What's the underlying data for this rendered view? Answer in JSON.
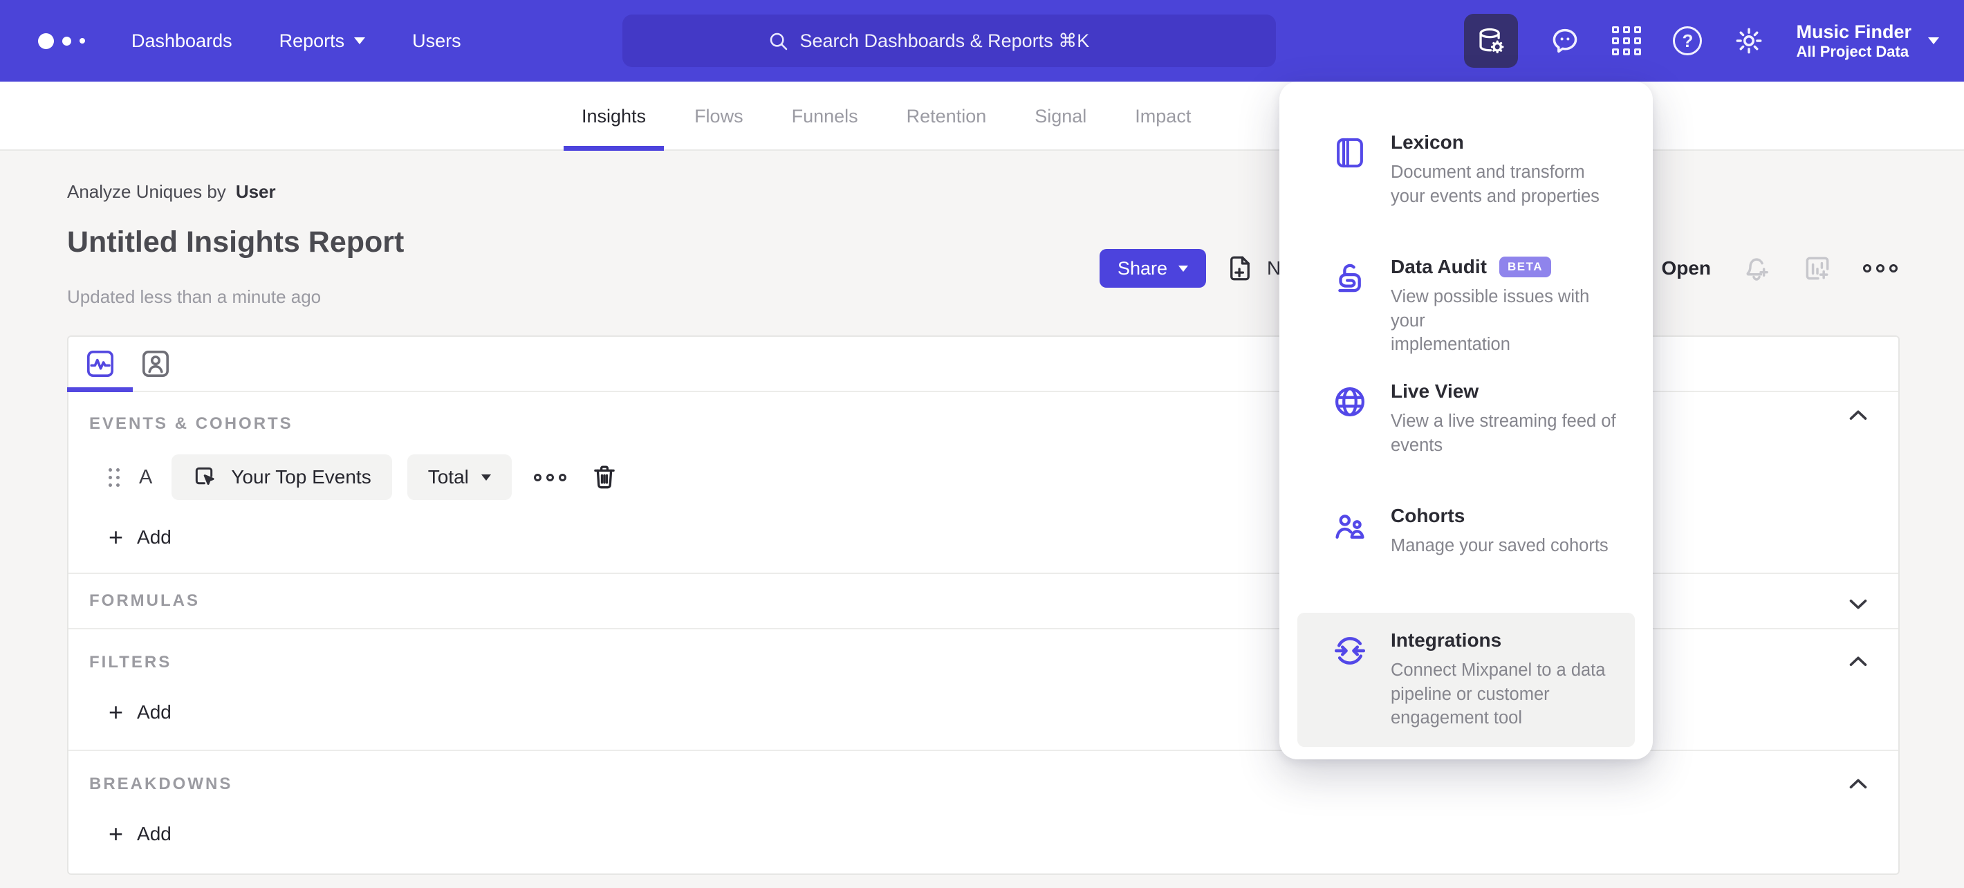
{
  "app": {
    "accent": "#4c43dd",
    "nav_bg": "#4b44d8",
    "page_bg": "#f6f5f4",
    "beta_badge_bg": "#8f84ec",
    "panel_icon_color": "#5348e8"
  },
  "nav": {
    "logo_icon": "mixpanel-dots-logo",
    "items": [
      {
        "label": "Dashboards"
      },
      {
        "label": "Reports",
        "caret": "caret-down-icon"
      },
      {
        "label": "Users"
      }
    ],
    "search": {
      "icon": "search-icon",
      "placeholder": "Search Dashboards & Reports ⌘K"
    },
    "right_icons": [
      {
        "name": "data-management-icon",
        "active": true
      },
      {
        "name": "feedback-chat-icon"
      },
      {
        "name": "apps-grid-icon"
      },
      {
        "name": "help-icon",
        "glyph": "?"
      },
      {
        "name": "settings-gear-icon"
      }
    ],
    "project": {
      "name": "Music Finder",
      "scope": "All Project Data",
      "caret": "caret-down-icon"
    }
  },
  "tabs": {
    "items": [
      {
        "label": "Insights",
        "active": true
      },
      {
        "label": "Flows"
      },
      {
        "label": "Funnels"
      },
      {
        "label": "Retention"
      },
      {
        "label": "Signal"
      },
      {
        "label": "Impact"
      }
    ]
  },
  "report": {
    "analyze_label": "Analyze Uniques by",
    "analyze_value": "User",
    "title": "Untitled Insights Report",
    "updated": "Updated less than a minute ago",
    "share": "Share",
    "new": "New",
    "open": "Open",
    "toolbar_icons": [
      "new-report-icon",
      "open-folder-icon",
      "add-alert-bell-icon",
      "add-to-board-icon",
      "more-ellipsis-icon"
    ]
  },
  "builder": {
    "tab_icons": [
      "pulse-chart-tab-icon",
      "profiles-tab-icon"
    ],
    "events": {
      "header": "EVENTS & COHORTS",
      "row": {
        "letter": "A",
        "event": "Your Top Events",
        "event_icon": "event-cursor-icon",
        "metric": "Total",
        "row_icons": [
          "drag-handle-icon",
          "more-ellipsis-icon",
          "trash-icon"
        ]
      },
      "add": "Add"
    },
    "formulas": {
      "header": "FORMULAS"
    },
    "filters": {
      "header": "FILTERS",
      "add": "Add"
    },
    "breakdowns": {
      "header": "BREAKDOWNS",
      "add": "Add"
    },
    "chevrons": {
      "events": "up",
      "formulas": "down",
      "filters": "up",
      "breakdowns": "up"
    }
  },
  "panel": {
    "items": [
      {
        "icon": "lexicon-book-icon",
        "title": "Lexicon",
        "desc": "Document and transform\nyour events and properties"
      },
      {
        "icon": "data-audit-lock-icon",
        "title": "Data Audit",
        "badge": "BETA",
        "desc": "View possible issues with your\nimplementation"
      },
      {
        "icon": "live-view-globe-icon",
        "title": "Live View",
        "desc": "View a live streaming feed of\nevents"
      },
      {
        "icon": "cohorts-users-icon",
        "title": "Cohorts",
        "desc": "Manage your saved cohorts"
      },
      {
        "icon": "integrations-sync-icon",
        "title": "Integrations",
        "desc": "Connect Mixpanel to a data\npipeline or customer\nengagement tool",
        "highlighted": true
      }
    ]
  }
}
